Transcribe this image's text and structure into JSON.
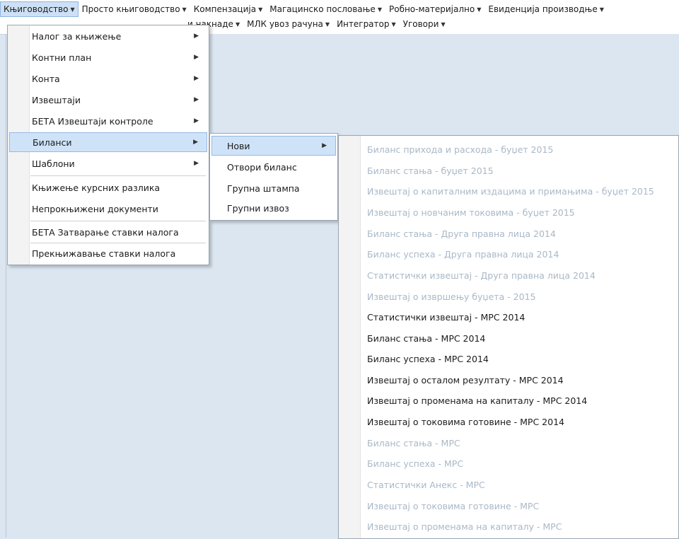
{
  "menubar": {
    "row1": [
      {
        "label": "Књиговодство",
        "active": true
      },
      {
        "label": "Просто књиговодство"
      },
      {
        "label": "Компензација"
      },
      {
        "label": "Магацинско пословање"
      },
      {
        "label": "Робно-материјално"
      },
      {
        "label": "Евиденција производње"
      }
    ],
    "row2": [
      {
        "label": "и накнаде"
      },
      {
        "label": "МЛК увоз рачуна"
      },
      {
        "label": "Интегратор"
      },
      {
        "label": "Уговори"
      }
    ]
  },
  "menu1": {
    "items": [
      {
        "label": "Налог за књижење",
        "submenu": true
      },
      {
        "label": "Контни план",
        "submenu": true
      },
      {
        "label": "Конта",
        "submenu": true
      },
      {
        "label": "Извештаји",
        "submenu": true
      },
      {
        "label": "БЕТА Извештаји контроле",
        "submenu": true
      },
      {
        "label": "Биланси",
        "submenu": true,
        "highlighted": true
      },
      {
        "label": "Шаблони",
        "submenu": true
      },
      {
        "label": "Књижење курсних разлика"
      },
      {
        "label": "Непрокњижени документи"
      },
      {
        "label": "БЕТА Затварање ставки налога"
      },
      {
        "label": "Прекњижавање ставки налога"
      }
    ]
  },
  "menu2": {
    "items": [
      {
        "label": "Нови",
        "submenu": true,
        "highlighted": true
      },
      {
        "label": "Отвори биланс"
      },
      {
        "label": "Групна штампа"
      },
      {
        "label": "Групни извоз"
      }
    ]
  },
  "menu3": {
    "items": [
      {
        "label": "Биланс прихода и расхода - буџет 2015",
        "enabled": false
      },
      {
        "label": "Биланс стања - буџет 2015",
        "enabled": false
      },
      {
        "label": "Извештај о капиталним издацима и примањима - буџет 2015",
        "enabled": false
      },
      {
        "label": "Извештај о новчаним токовима - буџет 2015",
        "enabled": false
      },
      {
        "label": "Биланс стања - Друга правна лица 2014",
        "enabled": false
      },
      {
        "label": "Биланс успеха - Друга правна лица 2014",
        "enabled": false
      },
      {
        "label": "Статистички извештај - Друга правна лица 2014",
        "enabled": false
      },
      {
        "label": "Извештај о извршењу буџета - 2015",
        "enabled": false
      },
      {
        "label": "Статистички извештај - МРС 2014",
        "enabled": true
      },
      {
        "label": "Биланс стања - МРС 2014",
        "enabled": true
      },
      {
        "label": "Биланс успеха - МРС 2014",
        "enabled": true
      },
      {
        "label": "Извештај о осталом резултату - МРС 2014",
        "enabled": true
      },
      {
        "label": "Извештај о променама на капиталу - МРС 2014",
        "enabled": true
      },
      {
        "label": "Извештај о токовима готовине - МРС 2014",
        "enabled": true
      },
      {
        "label": "Биланс стања - МРС",
        "enabled": false
      },
      {
        "label": "Биланс успеха - МРС",
        "enabled": false
      },
      {
        "label": "Статистички Анекс - МРС",
        "enabled": false
      },
      {
        "label": "Извештај о токовима готовине - МРС",
        "enabled": false
      },
      {
        "label": "Извештај о променама на капиталу - МРС",
        "enabled": false
      }
    ]
  },
  "icons": {
    "dropdown_caret": "caret-down-icon",
    "submenu_arrow": "caret-right-icon"
  },
  "colors": {
    "highlight_bg": "#cfe3f8",
    "highlight_border": "#95b9e3",
    "disabled_text": "#a9b8c6",
    "workspace_bg": "#dce6f0"
  }
}
